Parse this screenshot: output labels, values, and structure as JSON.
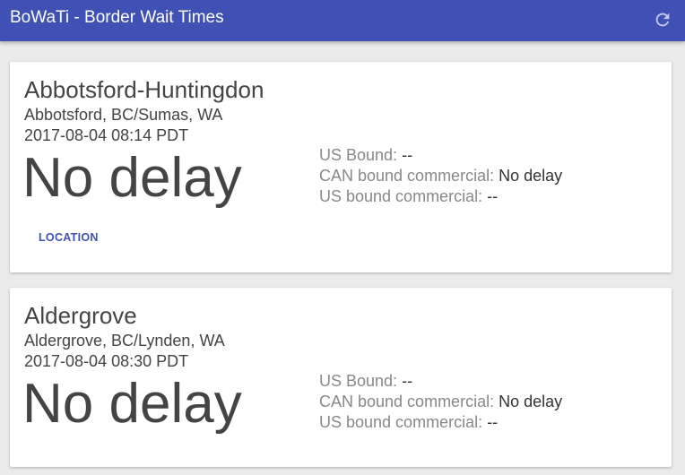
{
  "app": {
    "title": "BoWaTi - Border Wait Times",
    "refresh_icon": "refresh-icon"
  },
  "colors": {
    "appbar": "#3f51b5",
    "background": "#ebebeb",
    "card": "#ffffff",
    "accent_text": "#3f51b5"
  },
  "crossings": [
    {
      "name": "Abbotsford-Huntingdon",
      "location": "Abbotsford, BC/Sumas, WA",
      "updated": "2017-08-04 08:14 PDT",
      "delay": "No delay",
      "us_bound_label": "US Bound:",
      "us_bound_value": "--",
      "can_commercial_label": "CAN bound commercial:",
      "can_commercial_value": "No delay",
      "us_commercial_label": "US bound commercial:",
      "us_commercial_value": "--",
      "location_button": "LOCATION"
    },
    {
      "name": "Aldergrove",
      "location": "Aldergrove, BC/Lynden, WA",
      "updated": "2017-08-04 08:30 PDT",
      "delay": "No delay",
      "us_bound_label": "US Bound:",
      "us_bound_value": "--",
      "can_commercial_label": "CAN bound commercial:",
      "can_commercial_value": "No delay",
      "us_commercial_label": "US bound commercial:",
      "us_commercial_value": "--"
    }
  ]
}
